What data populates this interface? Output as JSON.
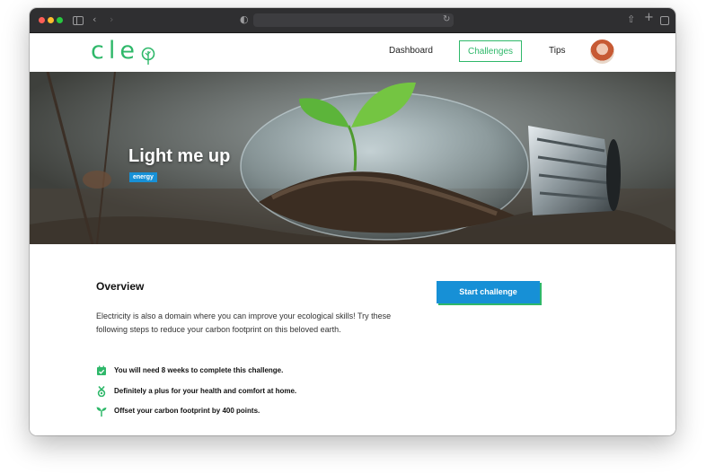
{
  "brand": {
    "logo_text": "cle"
  },
  "nav": {
    "dashboard": "Dashboard",
    "challenges": "Challenges",
    "tips": "Tips"
  },
  "hero": {
    "title": "Light me up",
    "tag": "energy"
  },
  "overview": {
    "title": "Overview",
    "description": "Electricity is also a domain where you can improve your ecological skills! Try these following steps to reduce your carbon footprint on this beloved earth.",
    "start_button": "Start challenge",
    "items": [
      {
        "icon": "calendar-check-icon",
        "text": "You will need 8 weeks to complete this challenge."
      },
      {
        "icon": "medal-icon",
        "text": "Definitely a plus for your health and comfort at home."
      },
      {
        "icon": "sprout-icon",
        "text": "Offset your carbon footprint by 400 points."
      }
    ]
  },
  "colors": {
    "brand_green": "#2fb86a",
    "accent_blue": "#1790d6"
  }
}
